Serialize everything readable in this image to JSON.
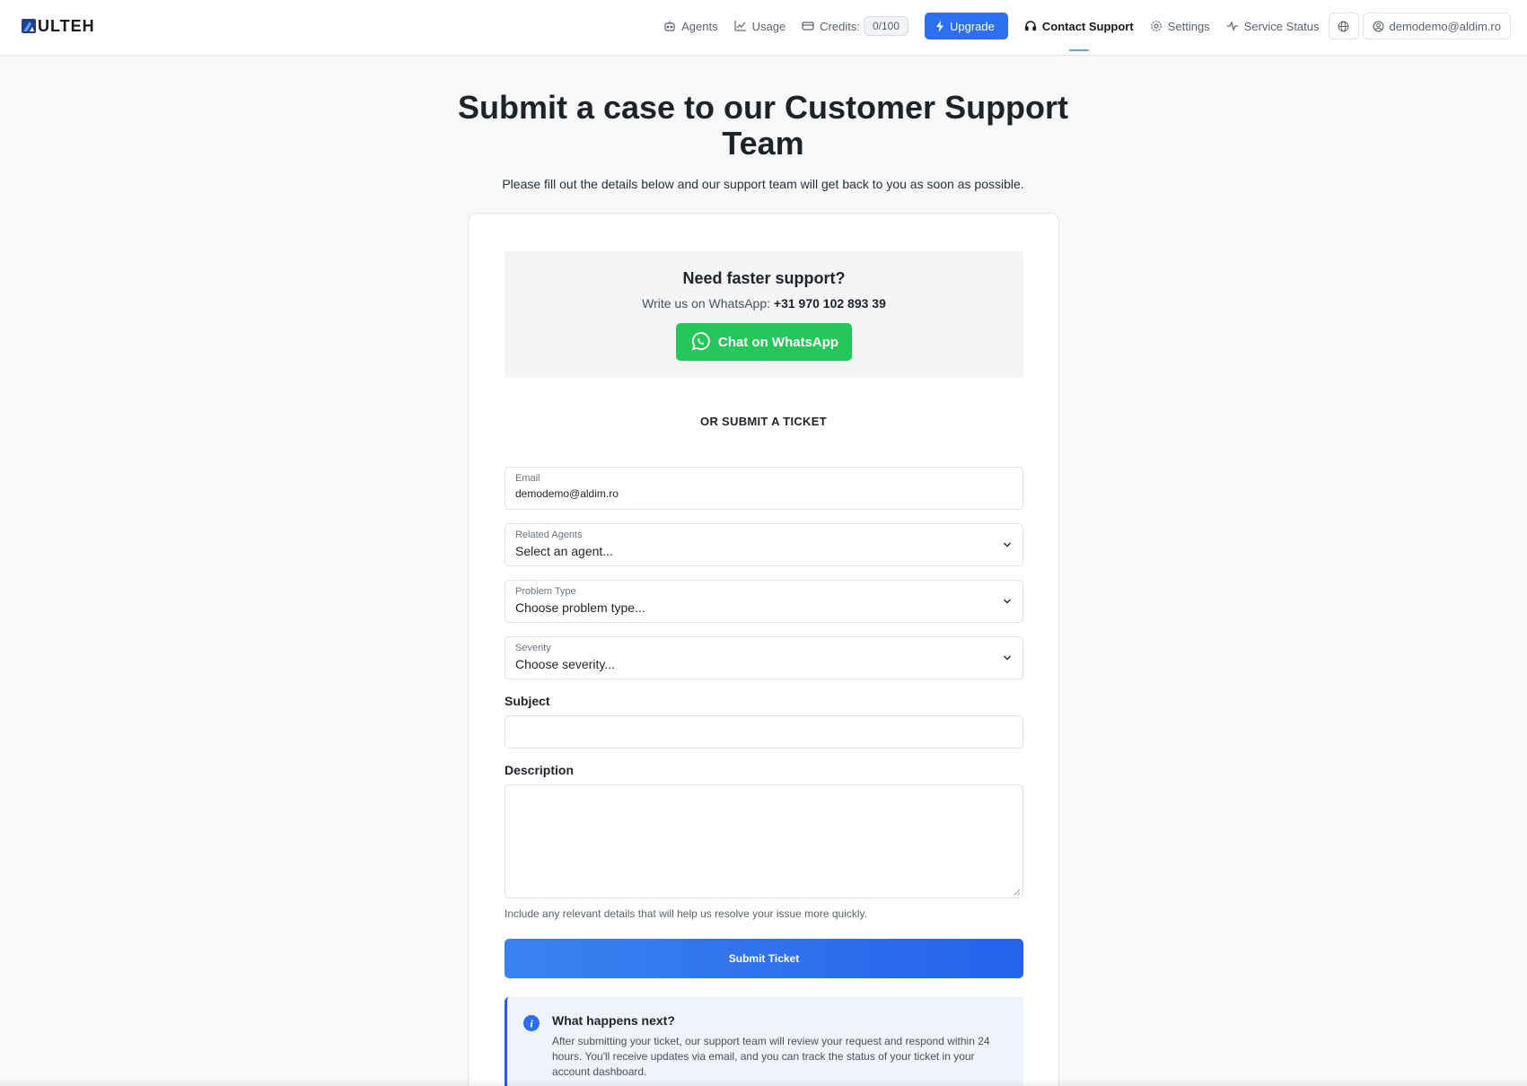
{
  "brand": {
    "name": "ULTEH"
  },
  "nav": {
    "agents": "Agents",
    "usage": "Usage",
    "credits_label": "Credits:",
    "credits_value": "0/100",
    "upgrade": "Upgrade",
    "contact_support": "Contact Support",
    "settings": "Settings",
    "service_status": "Service Status",
    "user_email": "demodemo@aldim.ro"
  },
  "header": {
    "title": "Submit a case to our Customer Support Team",
    "subtitle": "Please fill out the details below and our support team will get back to you as soon as possible."
  },
  "whatsapp": {
    "title": "Need faster support?",
    "line_prefix": "Write us on WhatsApp:",
    "phone": "+31 970 102 893 39",
    "button": "Chat on WhatsApp"
  },
  "form": {
    "divider": "OR SUBMIT A TICKET",
    "email": {
      "label": "Email",
      "value": "demodemo@aldim.ro"
    },
    "agents": {
      "label": "Related Agents",
      "value": "Select an agent..."
    },
    "problem_type": {
      "label": "Problem Type",
      "value": "Choose problem type..."
    },
    "severity": {
      "label": "Severity",
      "value": "Choose severity..."
    },
    "subject": {
      "label": "Subject",
      "value": ""
    },
    "description": {
      "label": "Description",
      "value": "",
      "help": "Include any relevant details that will help us resolve your issue more quickly."
    },
    "submit": "Submit Ticket"
  },
  "info": {
    "title": "What happens next?",
    "body": "After submitting your ticket, our support team will review your request and respond within 24 hours. You'll receive updates via email, and you can track the status of your ticket in your account dashboard."
  },
  "colors": {
    "primary": "#2c6ff0",
    "whatsapp": "#25c65a",
    "info_accent": "#2c5bd6"
  }
}
